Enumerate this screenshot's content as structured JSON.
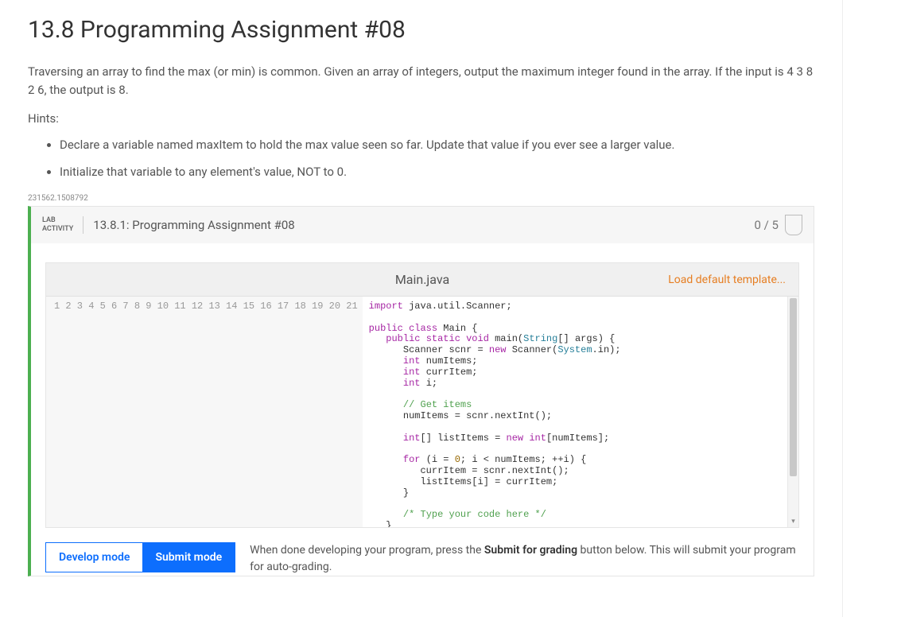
{
  "header": {
    "title": "13.8 Programming Assignment #08"
  },
  "description": "Traversing an array to find the max (or min) is common. Given an array of integers, output the maximum integer found in the array. If the input is 4 3 8 2 6, the output is 8.",
  "hints_label": "Hints:",
  "hints": [
    "Declare a variable named maxItem to hold the max value seen so far. Update that value if you ever see a larger value.",
    "Initialize that variable to any element's value, NOT to 0."
  ],
  "page_meta": "231562.1508792",
  "lab": {
    "activity_tag_line1": "LAB",
    "activity_tag_line2": "ACTIVITY",
    "title": "13.8.1: Programming Assignment #08",
    "score": "0 / 5"
  },
  "editor": {
    "filename": "Main.java",
    "load_default": "Load default template...",
    "line_count": 21
  },
  "code_lines": [
    [
      [
        "kw",
        "import"
      ],
      [
        "",
        " java.util.Scanner;"
      ]
    ],
    [
      [
        "",
        ""
      ]
    ],
    [
      [
        "kw",
        "public class"
      ],
      [
        "",
        " Main {"
      ]
    ],
    [
      [
        "",
        "   "
      ],
      [
        "kw",
        "public static void"
      ],
      [
        "",
        " main("
      ],
      [
        "type",
        "String"
      ],
      [
        "",
        "[] args) {"
      ]
    ],
    [
      [
        "",
        "      Scanner scnr = "
      ],
      [
        "kw",
        "new"
      ],
      [
        "",
        " Scanner("
      ],
      [
        "type",
        "System"
      ],
      [
        "",
        ".in);"
      ]
    ],
    [
      [
        "",
        "      "
      ],
      [
        "kw",
        "int"
      ],
      [
        "",
        " numItems;"
      ]
    ],
    [
      [
        "",
        "      "
      ],
      [
        "kw",
        "int"
      ],
      [
        "",
        " currItem;"
      ]
    ],
    [
      [
        "",
        "      "
      ],
      [
        "kw",
        "int"
      ],
      [
        "",
        " i;"
      ]
    ],
    [
      [
        "",
        ""
      ]
    ],
    [
      [
        "",
        "      "
      ],
      [
        "cmt2",
        "// Get items"
      ]
    ],
    [
      [
        "",
        "      numItems = scnr.nextInt();"
      ]
    ],
    [
      [
        "",
        ""
      ]
    ],
    [
      [
        "",
        "      "
      ],
      [
        "kw",
        "int"
      ],
      [
        "",
        "[] listItems = "
      ],
      [
        "kw",
        "new"
      ],
      [
        "",
        " "
      ],
      [
        "kw",
        "int"
      ],
      [
        "",
        "[numItems];"
      ]
    ],
    [
      [
        "",
        ""
      ]
    ],
    [
      [
        "",
        "      "
      ],
      [
        "kw",
        "for"
      ],
      [
        "",
        " (i = "
      ],
      [
        "num",
        "0"
      ],
      [
        "",
        "; i < numItems; ++i) {"
      ]
    ],
    [
      [
        "",
        "         currItem = scnr.nextInt();"
      ]
    ],
    [
      [
        "",
        "         listItems[i] = currItem;"
      ]
    ],
    [
      [
        "",
        "      }"
      ]
    ],
    [
      [
        "",
        ""
      ]
    ],
    [
      [
        "",
        "      "
      ],
      [
        "cmt2",
        "/* Type your code here */"
      ]
    ],
    [
      [
        "",
        "   }"
      ]
    ]
  ],
  "modes": {
    "develop": "Develop mode",
    "submit": "Submit mode",
    "desc_pre": "When done developing your program, press the ",
    "desc_bold": "Submit for grading",
    "desc_post": " button below. This will submit your program for auto-grading."
  }
}
